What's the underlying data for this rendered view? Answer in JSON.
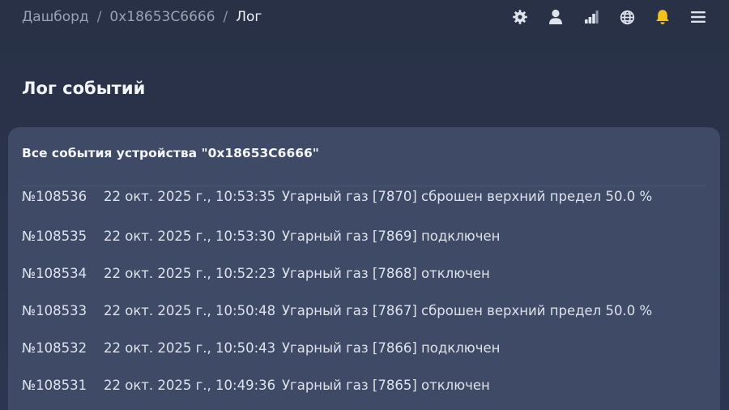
{
  "breadcrumb": {
    "items": [
      "Дашборд",
      "0x18653C6666"
    ],
    "separator": "/",
    "current": "Лог"
  },
  "header_icons": [
    "settings-icon",
    "user-icon",
    "stats-icon",
    "language-icon",
    "notifications-icon",
    "menu-icon"
  ],
  "accent_color": "#f5c21b",
  "page": {
    "title": "Лог событий"
  },
  "card": {
    "title": "Все события устройства \"0x18653C6666\""
  },
  "events": [
    {
      "id": "№108536",
      "time": "22 окт. 2025 г., 10:53:35",
      "message": "Угарный газ [7870] сброшен верхний предел 50.0 %"
    },
    {
      "id": "№108535",
      "time": "22 окт. 2025 г., 10:53:30",
      "message": "Угарный газ [7869] подключен"
    },
    {
      "id": "№108534",
      "time": "22 окт. 2025 г., 10:52:23",
      "message": "Угарный газ [7868] отключен"
    },
    {
      "id": "№108533",
      "time": "22 окт. 2025 г., 10:50:48",
      "message": "Угарный газ [7867] сброшен верхний предел 50.0 %"
    },
    {
      "id": "№108532",
      "time": "22 окт. 2025 г., 10:50:43",
      "message": "Угарный газ [7866] подключен"
    },
    {
      "id": "№108531",
      "time": "22 окт. 2025 г., 10:49:36",
      "message": "Угарный газ [7865] отключен"
    }
  ]
}
